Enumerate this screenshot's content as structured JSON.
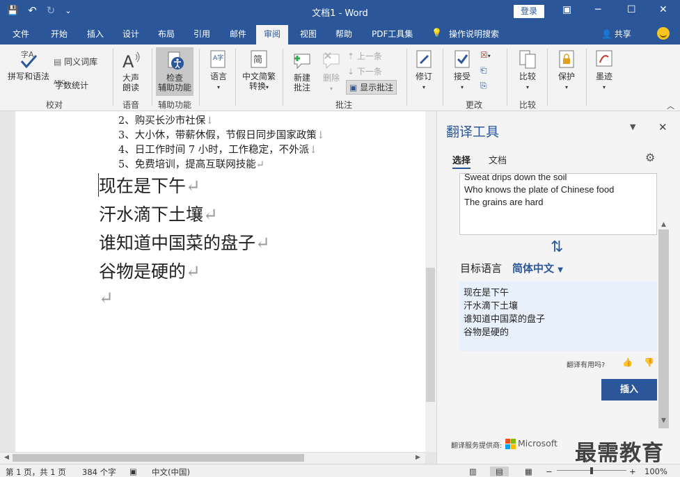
{
  "window": {
    "title": "文档1  -  Word",
    "login_label": "登录",
    "controls": [
      "▣",
      "─",
      "☐",
      "✕"
    ]
  },
  "qat": {
    "save": "💾",
    "undo": "↶",
    "redo": "↻",
    "customize": "⌄"
  },
  "tabs": [
    "文件",
    "开始",
    "插入",
    "设计",
    "布局",
    "引用",
    "邮件",
    "审阅",
    "视图",
    "帮助",
    "PDF工具集"
  ],
  "tell_me": "操作说明搜索",
  "share": "共享",
  "ribbon": {
    "spelling": "拼写和语法",
    "thesaurus": "同义词库",
    "word_count": "字数统计",
    "group_proofing": "校对",
    "read_aloud_1": "大声",
    "read_aloud_2": "朗读",
    "group_speech": "语音",
    "check_access_1": "检查",
    "check_access_2": "辅助功能",
    "group_access": "辅助功能",
    "language": "语言",
    "zh_convert_1": "中文简繁",
    "zh_convert_2": "转换",
    "new_comment_1": "新建",
    "new_comment_2": "批注",
    "delete": "删除",
    "previous": "上一条",
    "next": "下一条",
    "show_comments": "显示批注",
    "group_comments": "批注",
    "track": "修订",
    "accept": "接受",
    "group_changes": "更改",
    "compare": "比较",
    "group_compare": "比较",
    "protect": "保护",
    "ink": "墨迹"
  },
  "document": {
    "small_lines": [
      "2、购买长沙市社保",
      "3、大小休，带薪休假，节假日同步国家政策",
      "4、日工作时间 7 小时，工作稳定，不外派",
      "5、免费培训，提高互联网技能"
    ],
    "big_lines": [
      "现在是下午",
      "汗水滴下土壤",
      "谁知道中国菜的盘子",
      "谷物是硬的",
      ""
    ],
    "line_break_mark": "↓",
    "para_mark": "↵"
  },
  "translator": {
    "title": "翻译工具",
    "tab_selection": "选择",
    "tab_document": "文档",
    "source_lines": [
      "Sweat drips down the soil",
      "Who knows the plate of Chinese food",
      "The grains are hard"
    ],
    "target_label": "目标语言",
    "target_lang": "简体中文",
    "target_lines": [
      "现在是下午",
      "汗水滴下土壤",
      "谁知道中国菜的盘子",
      "谷物是硬的"
    ],
    "feedback": "翻译有用吗?",
    "insert": "插入",
    "provider": "翻译服务提供商:",
    "provider_name": "Microsoft"
  },
  "watermark": "最需教育",
  "status": {
    "page": "第 1 页，共 1 页",
    "words": "384 个字",
    "lang": "中文(中国)",
    "zoom": "100%"
  },
  "colors": {
    "brand": "#2b579a",
    "accent_yellow": "#f7c522"
  }
}
